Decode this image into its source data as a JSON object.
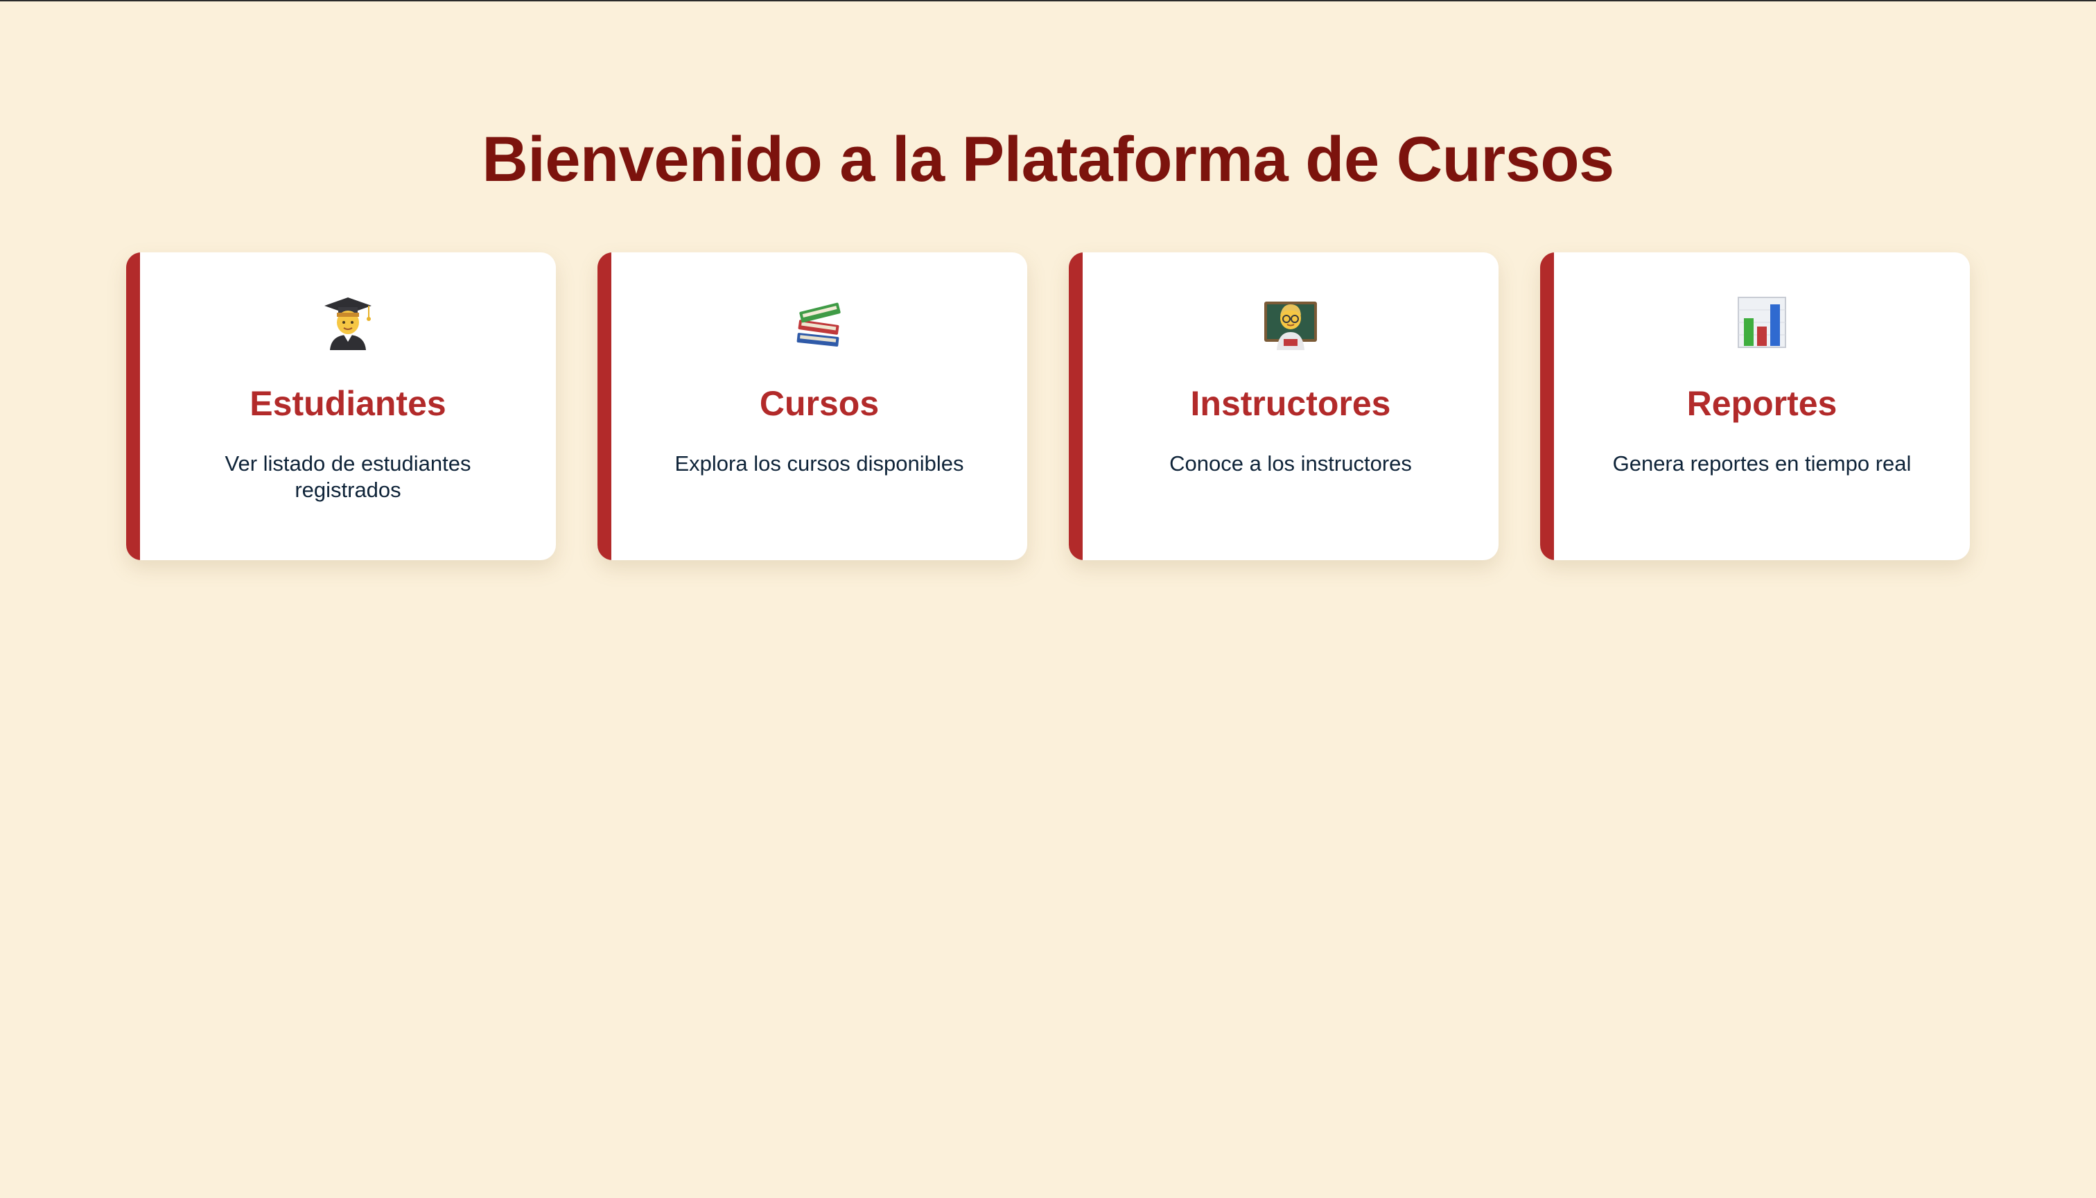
{
  "page": {
    "title": "Bienvenido a la Plataforma de Cursos"
  },
  "theme": {
    "background": "#fbf0da",
    "title_color": "#7c130d",
    "accent": "#b22a2a",
    "text_color": "#0e2338",
    "card_background": "#ffffff"
  },
  "cards": [
    {
      "icon": "student-icon",
      "title": "Estudiantes",
      "description": "Ver listado de estudiantes registrados"
    },
    {
      "icon": "books-icon",
      "title": "Cursos",
      "description": "Explora los cursos disponibles"
    },
    {
      "icon": "teacher-icon",
      "title": "Instructores",
      "description": "Conoce a los instructores"
    },
    {
      "icon": "bar-chart-icon",
      "title": "Reportes",
      "description": "Genera reportes en tiempo real"
    }
  ]
}
